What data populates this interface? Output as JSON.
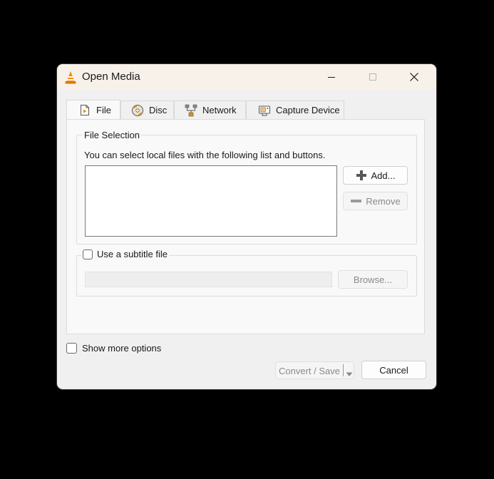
{
  "window": {
    "title": "Open Media",
    "icon": "vlc-cone-icon"
  },
  "tabs": [
    {
      "label": "File",
      "icon": "file-media-icon",
      "active": true
    },
    {
      "label": "Disc",
      "icon": "disc-icon",
      "active": false
    },
    {
      "label": "Network",
      "icon": "network-icon",
      "active": false
    },
    {
      "label": "Capture Device",
      "icon": "capture-device-icon",
      "active": false
    }
  ],
  "file_selection": {
    "legend": "File Selection",
    "hint": "You can select local files with the following list and buttons.",
    "add_label": "Add...",
    "remove_label": "Remove"
  },
  "subtitle": {
    "label": "Use a subtitle file",
    "checked": false,
    "browse_label": "Browse..."
  },
  "show_more_options": {
    "label": "Show more options",
    "checked": false
  },
  "footer": {
    "convert_label": "Convert / Save",
    "cancel_label": "Cancel"
  },
  "colors": {
    "titlebar": "#f7f1ea",
    "window_bg": "#f0f0f0",
    "panel_bg": "#f9f9f9",
    "vlc_orange": "#f08c00",
    "disabled_text": "#8a8a8a"
  }
}
